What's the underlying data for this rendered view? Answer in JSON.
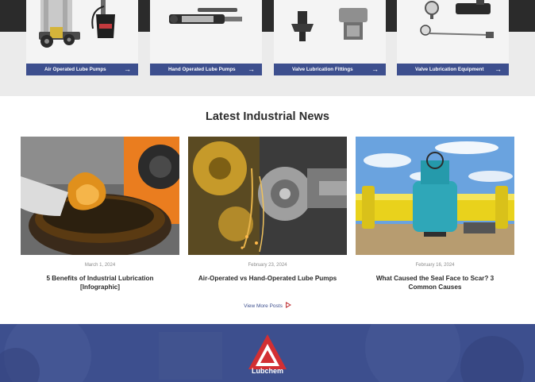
{
  "categories": [
    {
      "label": "Air Operated Lube Pumps",
      "icon": "arrow-right-icon"
    },
    {
      "label": "Hand Operated Lube Pumps",
      "icon": "arrow-right-icon"
    },
    {
      "label": "Valve Lubrication Fittings",
      "icon": "arrow-right-icon"
    },
    {
      "label": "Valve Lubrication Equipment",
      "icon": "arrow-right-icon"
    }
  ],
  "news": {
    "title": "Latest Industrial News",
    "posts": [
      {
        "date": "March 1, 2024",
        "headline": "5 Benefits of Industrial Lubrication [Infographic]"
      },
      {
        "date": "February 23, 2024",
        "headline": "Air-Operated vs Hand-Operated Lube Pumps"
      },
      {
        "date": "February 16, 2024",
        "headline": "What Caused the Seal Face to Scar? 3 Common Causes"
      }
    ],
    "view_more": "View More Posts"
  },
  "footer": {
    "brand": "Lubchem"
  },
  "colors": {
    "brand_blue": "#3d4f8e",
    "brand_red": "#c23a3e"
  }
}
